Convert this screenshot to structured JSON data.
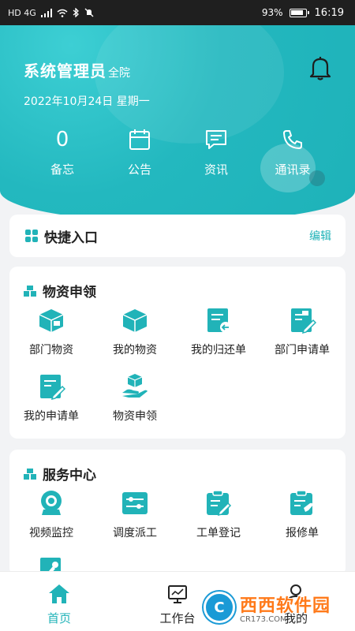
{
  "status_bar": {
    "left_indicators": "HD 4G",
    "battery": "93%",
    "time": "16:19"
  },
  "header": {
    "user_name": "系统管理员",
    "user_scope": "全院",
    "date": "2022年10月24日 星期一",
    "stats": [
      {
        "value": "0",
        "label": "备忘",
        "icon": "memo"
      },
      {
        "value": "",
        "label": "公告",
        "icon": "calendar-icon"
      },
      {
        "value": "",
        "label": "资讯",
        "icon": "message-icon"
      },
      {
        "value": "",
        "label": "通讯录",
        "icon": "phone-icon"
      }
    ]
  },
  "quick_entry": {
    "title": "快捷入口",
    "edit": "编辑"
  },
  "supplies": {
    "title": "物资申领",
    "items": [
      {
        "label": "部门物资",
        "icon": "department-box-icon"
      },
      {
        "label": "我的物资",
        "icon": "box-icon"
      },
      {
        "label": "我的归还单",
        "icon": "return-form-icon"
      },
      {
        "label": "部门申请单",
        "icon": "department-form-icon"
      },
      {
        "label": "我的申请单",
        "icon": "application-form-icon"
      },
      {
        "label": "物资申领",
        "icon": "hand-box-icon"
      }
    ]
  },
  "service": {
    "title": "服务中心",
    "items": [
      {
        "label": "视频监控",
        "icon": "camera-icon"
      },
      {
        "label": "调度派工",
        "icon": "dispatch-icon"
      },
      {
        "label": "工单登记",
        "icon": "work-order-icon"
      },
      {
        "label": "报修单",
        "icon": "repair-form-icon"
      },
      {
        "label": "",
        "icon": "tools-form-icon"
      }
    ]
  },
  "tabbar": {
    "tabs": [
      {
        "label": "首页",
        "icon": "home-icon",
        "active": true
      },
      {
        "label": "工作台",
        "icon": "monitor-icon",
        "active": false
      },
      {
        "label": "我的",
        "icon": "user-icon",
        "active": false
      }
    ]
  },
  "watermark": {
    "main": "西西软件园",
    "sub": "CR173.COM",
    "logo": "C"
  },
  "colors": {
    "accent": "#21b3b8",
    "header": "#23b8bf"
  }
}
